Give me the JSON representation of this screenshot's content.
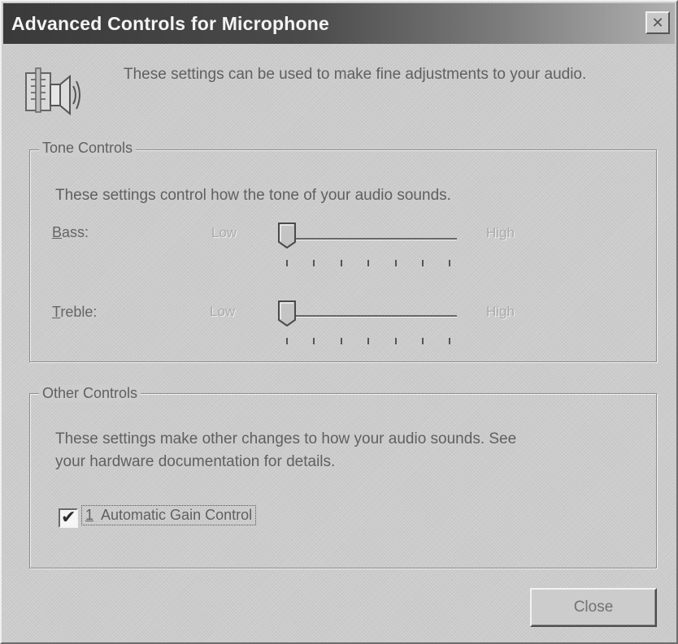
{
  "window": {
    "title": "Advanced Controls for Microphone",
    "close_glyph": "✕"
  },
  "header": {
    "icon": "mixer-speaker-icon",
    "text": "These settings can be used to make fine adjustments to your audio."
  },
  "tone_controls": {
    "legend": "Tone Controls",
    "description": "These settings control how the tone of your audio sounds.",
    "bass": {
      "label_first": "B",
      "label_rest": "ass:",
      "low_label": "Low",
      "high_label": "High",
      "position_fraction": 0.0
    },
    "treble": {
      "label_first": "T",
      "label_rest": "reble:",
      "low_label": "Low",
      "high_label": "High",
      "position_fraction": 0.0
    }
  },
  "other_controls": {
    "legend": "Other Controls",
    "description_line1": "These settings make other changes to how your audio sounds.  See",
    "description_line2": "your hardware documentation for details.",
    "agc_checkbox": {
      "label_first": "1",
      "label_rest": "  Automatic Gain Control",
      "checked": true
    }
  },
  "buttons": {
    "close_label": "Close"
  },
  "colors": {
    "titlebar_dark": "#3a3a3a",
    "dialog_face": "#cdcdcd"
  }
}
